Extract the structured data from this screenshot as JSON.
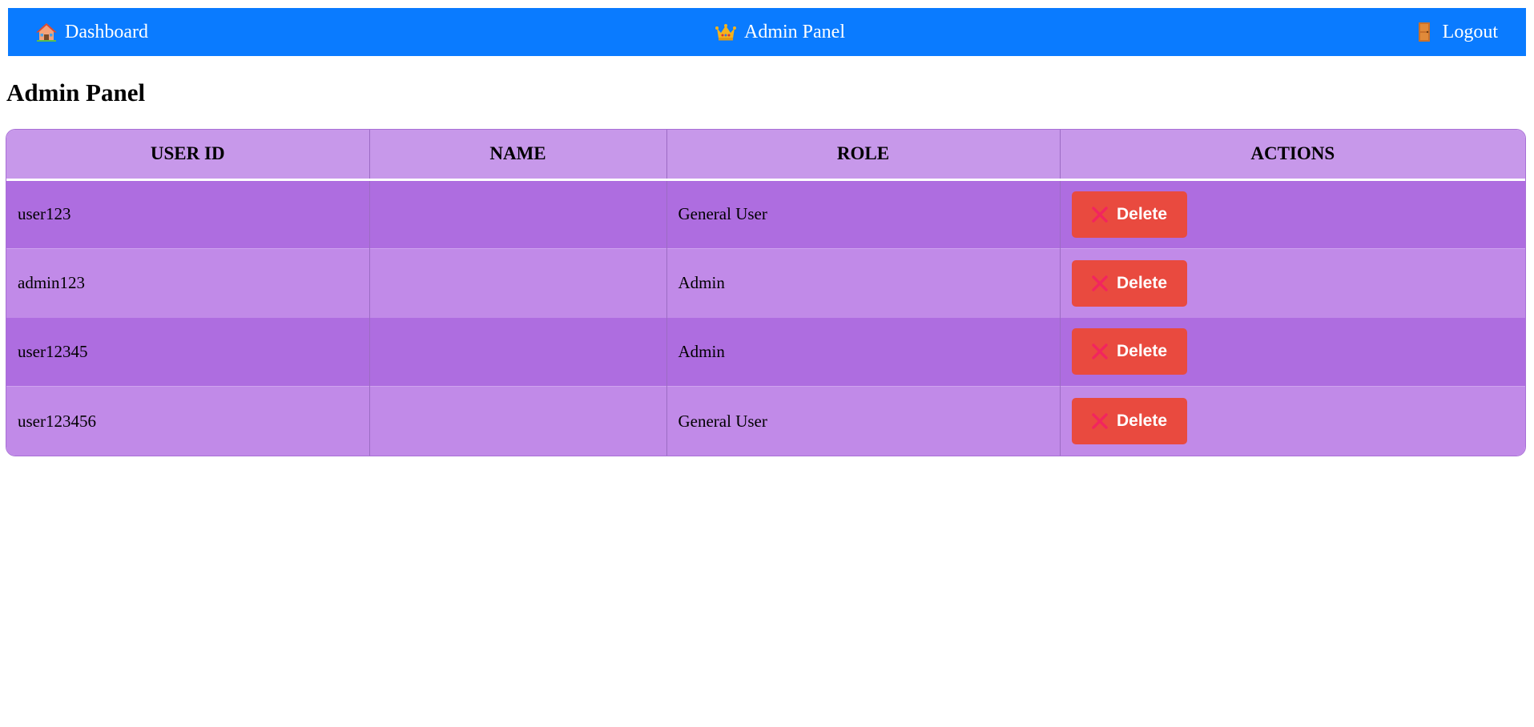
{
  "nav": {
    "dashboard": {
      "label": "Dashboard",
      "icon": "house-icon"
    },
    "admin": {
      "label": "Admin Panel",
      "icon": "crown-icon"
    },
    "logout": {
      "label": "Logout",
      "icon": "door-icon"
    },
    "background": "#0a7bff"
  },
  "page": {
    "title": "Admin Panel"
  },
  "table": {
    "headers": [
      "USER ID",
      "NAME",
      "ROLE",
      "ACTIONS"
    ],
    "rows": [
      {
        "user_id": "user123",
        "name": "",
        "role": "General User",
        "action": "Delete"
      },
      {
        "user_id": "admin123",
        "name": "",
        "role": "Admin",
        "action": "Delete"
      },
      {
        "user_id": "user12345",
        "name": "",
        "role": "Admin",
        "action": "Delete"
      },
      {
        "user_id": "user123456",
        "name": "",
        "role": "General User",
        "action": "Delete"
      }
    ],
    "colors": {
      "header": "#c798ea",
      "row_odd": "#ae6de0",
      "row_even": "#c18ae8",
      "delete_button": "#e94a3f",
      "delete_icon": "#f2255e"
    }
  }
}
